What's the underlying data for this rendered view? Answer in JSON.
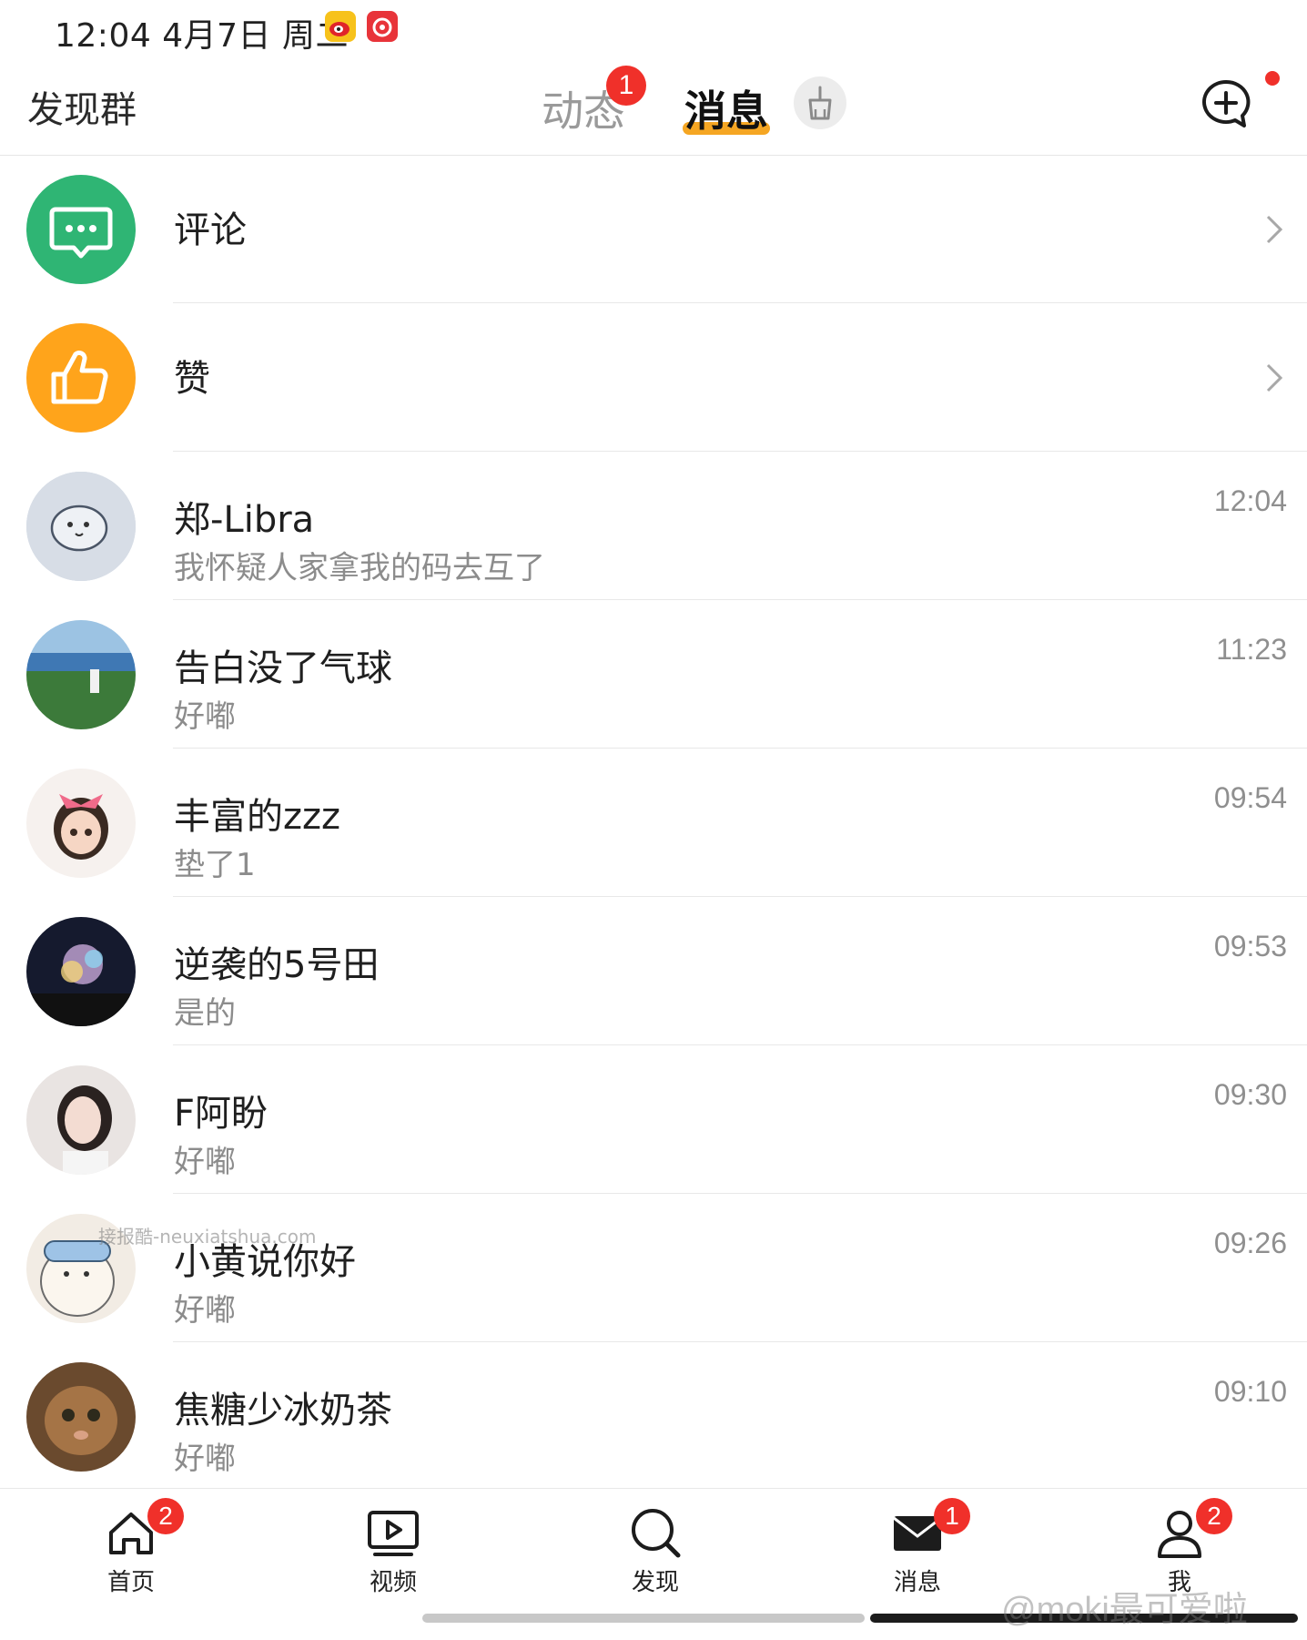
{
  "status_bar": {
    "time": "12:04 4月7日 周二"
  },
  "header": {
    "left_label": "发现群",
    "tab_dynamic": "动态",
    "tab_dynamic_badge": "1",
    "tab_messages": "消息"
  },
  "rows": [
    {
      "title": "评论",
      "subtitle": "",
      "time": ""
    },
    {
      "title": "赞",
      "subtitle": "",
      "time": ""
    },
    {
      "title": "郑-Libra",
      "subtitle": "我怀疑人家拿我的码去互了",
      "time": "12:04"
    },
    {
      "title": "告白没了气球",
      "subtitle": "好嘟",
      "time": "11:23"
    },
    {
      "title": "丰富的zzz",
      "subtitle": "垫了1",
      "time": "09:54"
    },
    {
      "title": "逆袭的5号田",
      "subtitle": "是的",
      "time": "09:53"
    },
    {
      "title": "F阿盼",
      "subtitle": "好嘟",
      "time": "09:30"
    },
    {
      "title": "小黄说你好",
      "subtitle": "好嘟",
      "time": "09:26"
    },
    {
      "title": "焦糖少冰奶茶",
      "subtitle": "好嘟",
      "time": "09:10"
    }
  ],
  "bottom_nav": [
    {
      "label": "首页",
      "badge": "2"
    },
    {
      "label": "视频",
      "badge": ""
    },
    {
      "label": "发现",
      "badge": ""
    },
    {
      "label": "消息",
      "badge": "1"
    },
    {
      "label": "我",
      "badge": "2"
    }
  ],
  "watermark": "@moki最可爱啦",
  "overlay_watermark": "接报酷-neuxiatshua.com",
  "colors": {
    "accent": "#f5a623",
    "badge": "#f0302a",
    "comment_icon_bg": "#2fb574",
    "like_icon_bg": "#ffa41b"
  }
}
